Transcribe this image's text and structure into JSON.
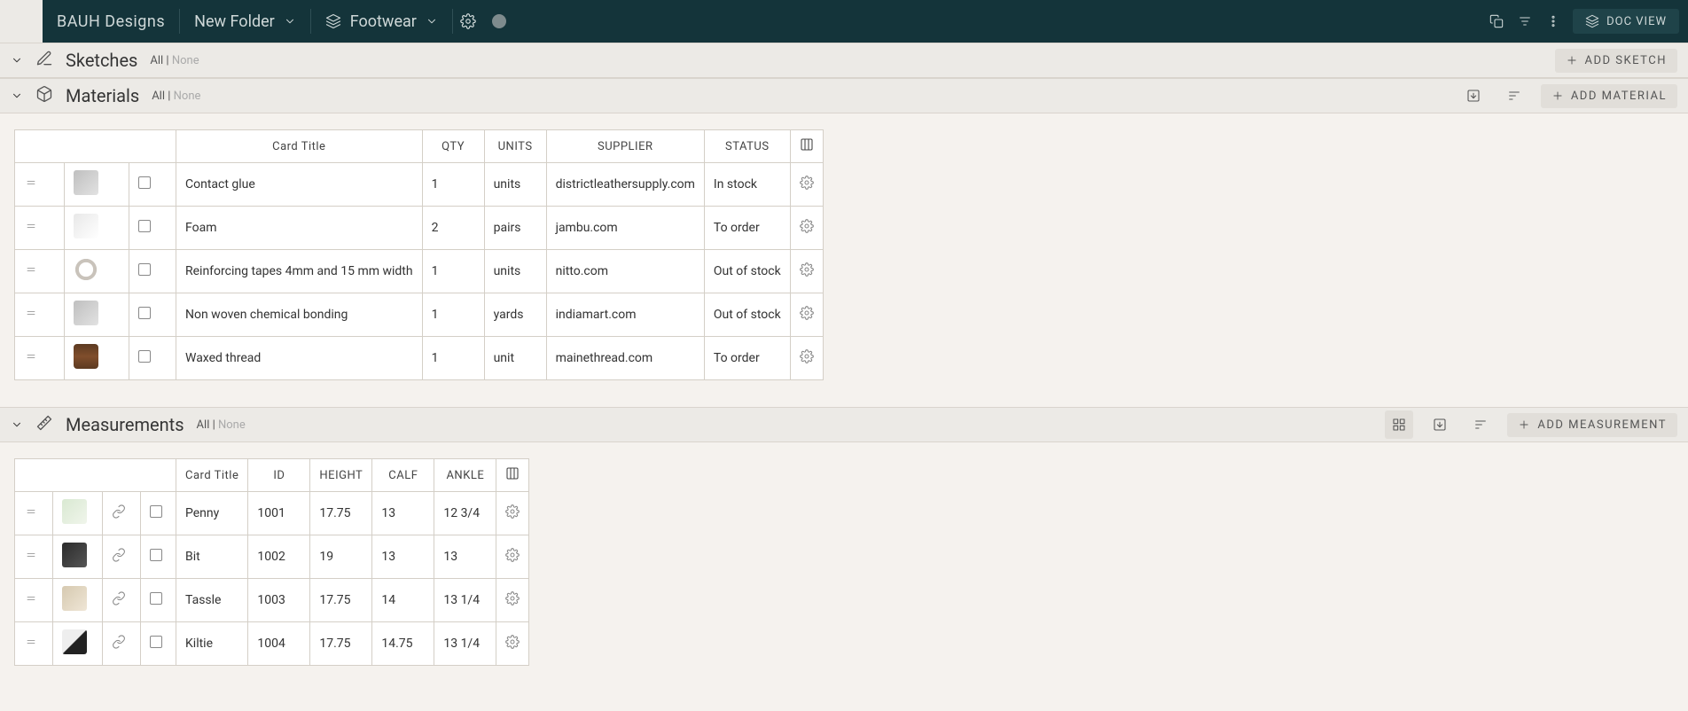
{
  "header": {
    "brand": "BAUH Designs",
    "folder": "New Folder",
    "project": "Footwear",
    "doc_view": "DOC VIEW"
  },
  "sections": {
    "sketches": {
      "title": "Sketches",
      "filter_all": "All",
      "filter_none": "None",
      "add": "ADD SKETCH"
    },
    "materials": {
      "title": "Materials",
      "filter_all": "All",
      "filter_none": "None",
      "add": "ADD MATERIAL"
    },
    "measurements": {
      "title": "Measurements",
      "filter_all": "All",
      "filter_none": "None",
      "add": "ADD MEASUREMENT"
    }
  },
  "materials_table": {
    "headers": {
      "card_title": "Card Title",
      "qty": "QTY",
      "units": "UNITS",
      "supplier": "SUPPLIER",
      "status": "STATUS"
    },
    "rows": [
      {
        "title": "Contact glue",
        "qty": "1",
        "units": "units",
        "supplier": "districtleathersupply.com",
        "status": "In stock"
      },
      {
        "title": "Foam",
        "qty": "2",
        "units": "pairs",
        "supplier": "jambu.com",
        "status": "To order"
      },
      {
        "title": "Reinforcing tapes 4mm and 15 mm width",
        "qty": "1",
        "units": "units",
        "supplier": "nitto.com",
        "status": "Out of stock"
      },
      {
        "title": "Non woven chemical bonding",
        "qty": "1",
        "units": "yards",
        "supplier": "indiamart.com",
        "status": "Out of stock"
      },
      {
        "title": "Waxed thread",
        "qty": "1",
        "units": "unit",
        "supplier": "mainethread.com",
        "status": "To order"
      }
    ]
  },
  "measurements_table": {
    "headers": {
      "card_title": "Card Title",
      "id": "ID",
      "height": "HEIGHT",
      "calf": "CALF",
      "ankle": "ANKLE"
    },
    "rows": [
      {
        "title": "Penny",
        "id": "1001",
        "height": "17.75",
        "calf": "13",
        "ankle": "12 3/4"
      },
      {
        "title": "Bit",
        "id": "1002",
        "height": "19",
        "calf": "13",
        "ankle": "13"
      },
      {
        "title": "Tassle",
        "id": "1003",
        "height": "17.75",
        "calf": "14",
        "ankle": "13 1/4"
      },
      {
        "title": "Kiltie",
        "id": "1004",
        "height": "17.75",
        "calf": "14.75",
        "ankle": "13 1/4"
      }
    ]
  }
}
